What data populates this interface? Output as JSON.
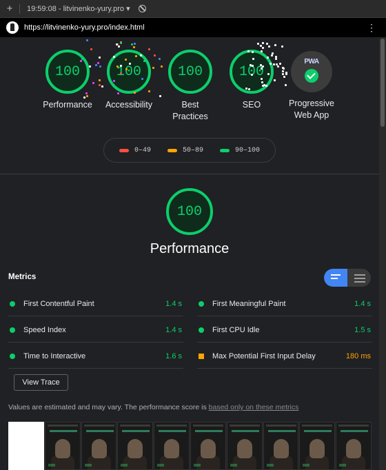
{
  "topbar": {
    "new_tab_icon": "plus-icon",
    "report_label": "19:59:08 - litvinenko-yury.pro ▾",
    "clear_icon": "block-icon"
  },
  "urlbar": {
    "url": "https://litvinenko-yury.pro/index.html",
    "menu_icon": "⋮"
  },
  "gauges": [
    {
      "score": "100",
      "label": "Performance"
    },
    {
      "score": "100",
      "label": "Accessibility"
    },
    {
      "score": "100",
      "label": "Best Practices"
    },
    {
      "score": "100",
      "label": "SEO"
    }
  ],
  "pwa": {
    "badge_text": "PWA",
    "label": "Progressive Web App"
  },
  "legend": [
    {
      "range": "0–49",
      "color": "#ff4e42"
    },
    {
      "range": "50–89",
      "color": "#ffa400"
    },
    {
      "range": "90–100",
      "color": "#0cce6b"
    }
  ],
  "performance": {
    "score": "100",
    "title": "Performance"
  },
  "metrics": {
    "heading": "Metrics",
    "items": [
      {
        "name": "First Contentful Paint",
        "value": "1.4 s",
        "status": "pass"
      },
      {
        "name": "First Meaningful Paint",
        "value": "1.4 s",
        "status": "pass"
      },
      {
        "name": "Speed Index",
        "value": "1.4 s",
        "status": "pass"
      },
      {
        "name": "First CPU Idle",
        "value": "1.5 s",
        "status": "pass"
      },
      {
        "name": "Time to Interactive",
        "value": "1.6 s",
        "status": "pass"
      },
      {
        "name": "Max Potential First Input Delay",
        "value": "180 ms",
        "status": "average"
      }
    ]
  },
  "view_trace": "View Trace",
  "note": {
    "text": "Values are estimated and may vary. The performance score is ",
    "link": "based only on these metrics"
  },
  "colors": {
    "pass": "#0cce6b",
    "average": "#ffa400",
    "fail": "#ff4e42",
    "accent": "#4285f4"
  }
}
